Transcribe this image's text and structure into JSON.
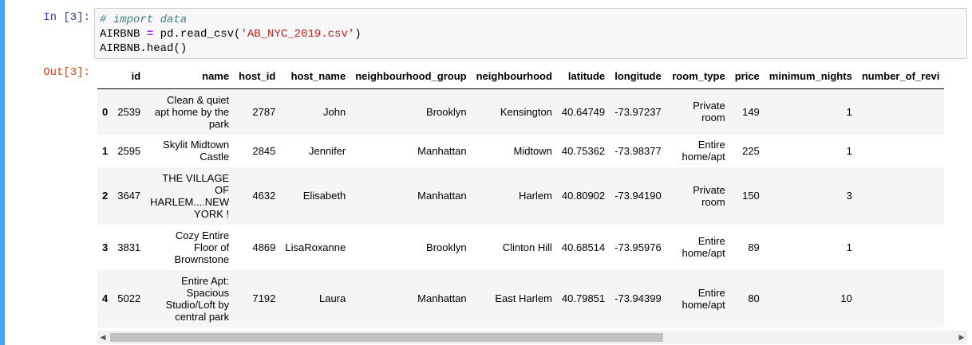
{
  "cell": {
    "in_prompt": "In [3]:",
    "out_prompt": "Out[3]:",
    "code": {
      "comment": "# import data",
      "line2_var": "AIRBNB ",
      "line2_op": "=",
      "line2_call": " pd.read_csv(",
      "line2_str": "'AB_NYC_2019.csv'",
      "line2_close": ")",
      "line3": "AIRBNB.head()"
    }
  },
  "table": {
    "columns": [
      "",
      "id",
      "name",
      "host_id",
      "host_name",
      "neighbourhood_group",
      "neighbourhood",
      "latitude",
      "longitude",
      "room_type",
      "price",
      "minimum_nights",
      "number_of_revi"
    ],
    "rows": [
      {
        "index": "0",
        "id": "2539",
        "name": "Clean & quiet apt home by the park",
        "host_id": "2787",
        "host_name": "John",
        "neighbourhood_group": "Brooklyn",
        "neighbourhood": "Kensington",
        "latitude": "40.64749",
        "longitude": "-73.97237",
        "room_type": "Private room",
        "price": "149",
        "minimum_nights": "1",
        "number_of_reviews": ""
      },
      {
        "index": "1",
        "id": "2595",
        "name": "Skylit Midtown Castle",
        "host_id": "2845",
        "host_name": "Jennifer",
        "neighbourhood_group": "Manhattan",
        "neighbourhood": "Midtown",
        "latitude": "40.75362",
        "longitude": "-73.98377",
        "room_type": "Entire home/apt",
        "price": "225",
        "minimum_nights": "1",
        "number_of_reviews": ""
      },
      {
        "index": "2",
        "id": "3647",
        "name": "THE VILLAGE OF HARLEM....NEW YORK !",
        "host_id": "4632",
        "host_name": "Elisabeth",
        "neighbourhood_group": "Manhattan",
        "neighbourhood": "Harlem",
        "latitude": "40.80902",
        "longitude": "-73.94190",
        "room_type": "Private room",
        "price": "150",
        "minimum_nights": "3",
        "number_of_reviews": ""
      },
      {
        "index": "3",
        "id": "3831",
        "name": "Cozy Entire Floor of Brownstone",
        "host_id": "4869",
        "host_name": "LisaRoxanne",
        "neighbourhood_group": "Brooklyn",
        "neighbourhood": "Clinton Hill",
        "latitude": "40.68514",
        "longitude": "-73.95976",
        "room_type": "Entire home/apt",
        "price": "89",
        "minimum_nights": "1",
        "number_of_reviews": ""
      },
      {
        "index": "4",
        "id": "5022",
        "name": "Entire Apt: Spacious Studio/Loft by central park",
        "host_id": "7192",
        "host_name": "Laura",
        "neighbourhood_group": "Manhattan",
        "neighbourhood": "East Harlem",
        "latitude": "40.79851",
        "longitude": "-73.94399",
        "room_type": "Entire home/apt",
        "price": "80",
        "minimum_nights": "10",
        "number_of_reviews": ""
      }
    ]
  },
  "scrollbar": {
    "left_arrow": "◀",
    "right_arrow": "▶"
  }
}
